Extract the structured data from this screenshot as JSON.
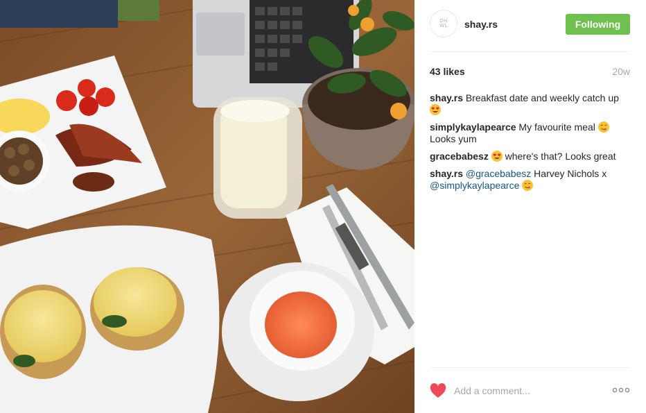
{
  "post": {
    "username": "shay.rs",
    "avatar_text": [
      "DH",
      "WL"
    ],
    "follow_label": "Following",
    "likes": "43 likes",
    "time_ago": "20w",
    "add_comment_placeholder": "Add a comment...",
    "comments": [
      {
        "user": "shay.rs",
        "text_before": "Breakfast date and weekly catch up",
        "emoji": "heart-eyes-emoji"
      },
      {
        "user": "simplykaylapearce",
        "text_before": "My favourite meal",
        "emoji": "yum-emoji",
        "text_after": "Looks yum"
      },
      {
        "user": "gracebabesz",
        "emoji": "heart-eyes-emoji",
        "text_after": "where's that? Looks great"
      },
      {
        "user": "shay.rs",
        "mention1": "@gracebabesz",
        "text_before": "Harvey Nichols x",
        "mention2": "@simplykaylapearce",
        "emoji": "yum-emoji"
      }
    ]
  },
  "colors": {
    "follow_green": "#70c050",
    "heart_red": "#ed4956",
    "mention_blue": "#125688",
    "muted_gray": "#a5a7aa"
  },
  "icons": [
    "heart-icon",
    "more-options-icon",
    "heart-eyes-emoji",
    "yum-emoji"
  ]
}
